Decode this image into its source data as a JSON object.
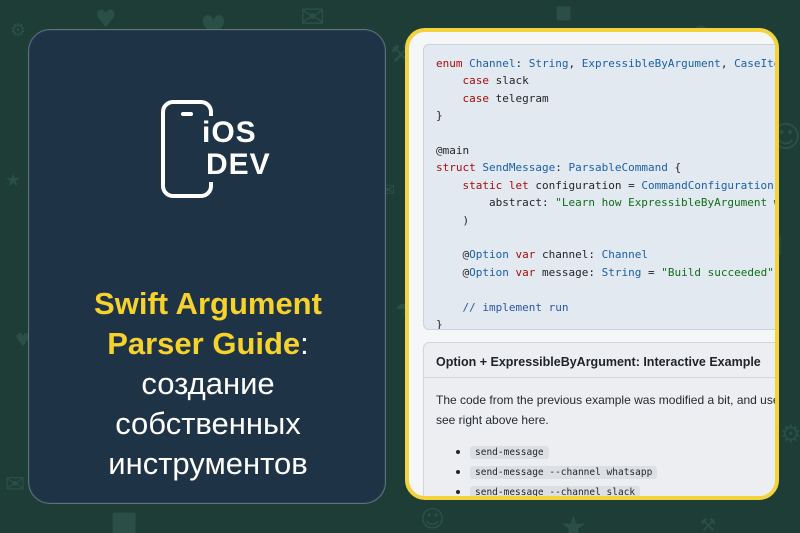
{
  "background": {
    "color": "#1d3d36",
    "pattern_icons": [
      "iOS DEV",
      "iOS DEV",
      "iOS DEV",
      "iOS DEV",
      "iOS DEV"
    ]
  },
  "left_card": {
    "logo": {
      "line1": "iOS",
      "line2": "DEV"
    },
    "title_highlight_1": "Swift Argument",
    "title_highlight_2": "Parser Guide",
    "title_colon": ":",
    "subtitle_lines": [
      "создание",
      "собственных",
      "инструментов"
    ],
    "accent_color": "#f6d22d"
  },
  "right_card": {
    "border_color": "#f2d33a",
    "code_lines": [
      [
        {
          "t": "enum",
          "c": "kw"
        },
        {
          "t": " "
        },
        {
          "t": "Channel",
          "c": "ty"
        },
        {
          "t": ": "
        },
        {
          "t": "String",
          "c": "ty"
        },
        {
          "t": ", "
        },
        {
          "t": "ExpressibleByArgument",
          "c": "ty"
        },
        {
          "t": ", "
        },
        {
          "t": "CaseIterable",
          "c": "ty"
        }
      ],
      [
        {
          "t": "    "
        },
        {
          "t": "case",
          "c": "kw"
        },
        {
          "t": " slack"
        }
      ],
      [
        {
          "t": "    "
        },
        {
          "t": "case",
          "c": "kw"
        },
        {
          "t": " telegram"
        }
      ],
      [
        {
          "t": "}"
        }
      ],
      [
        {
          "t": ""
        }
      ],
      [
        {
          "t": "@main"
        }
      ],
      [
        {
          "t": "struct",
          "c": "kw"
        },
        {
          "t": " "
        },
        {
          "t": "SendMessage",
          "c": "ty"
        },
        {
          "t": ": "
        },
        {
          "t": "ParsableCommand",
          "c": "ty"
        },
        {
          "t": " {"
        }
      ],
      [
        {
          "t": "    "
        },
        {
          "t": "static",
          "c": "kw"
        },
        {
          "t": " "
        },
        {
          "t": "let",
          "c": "kw"
        },
        {
          "t": " configuration = "
        },
        {
          "t": "CommandConfiguration",
          "c": "ty"
        },
        {
          "t": "("
        }
      ],
      [
        {
          "t": "        abstract: "
        },
        {
          "t": "\"Learn how ExpressibleByArgument works\"",
          "c": "st"
        }
      ],
      [
        {
          "t": "    )"
        }
      ],
      [
        {
          "t": ""
        }
      ],
      [
        {
          "t": "    @"
        },
        {
          "t": "Option",
          "c": "ty"
        },
        {
          "t": " "
        },
        {
          "t": "var",
          "c": "kw"
        },
        {
          "t": " channel: "
        },
        {
          "t": "Channel",
          "c": "ty"
        }
      ],
      [
        {
          "t": "    @"
        },
        {
          "t": "Option",
          "c": "ty"
        },
        {
          "t": " "
        },
        {
          "t": "var",
          "c": "kw"
        },
        {
          "t": " message: "
        },
        {
          "t": "String",
          "c": "ty"
        },
        {
          "t": " = "
        },
        {
          "t": "\"Build succeeded\"",
          "c": "st"
        }
      ],
      [
        {
          "t": ""
        }
      ],
      [
        {
          "t": "    "
        },
        {
          "t": "// implement run",
          "c": "cm"
        }
      ],
      [
        {
          "t": "}"
        }
      ]
    ],
    "info_title": "Option + ExpressibleByArgument: Interactive Example",
    "info_text_lines": [
      "The code from the previous example was modified a bit, and uses",
      "see right above here."
    ],
    "commands": [
      "send-message",
      "send-message --channel whatsapp",
      "send-message --channel slack"
    ]
  }
}
